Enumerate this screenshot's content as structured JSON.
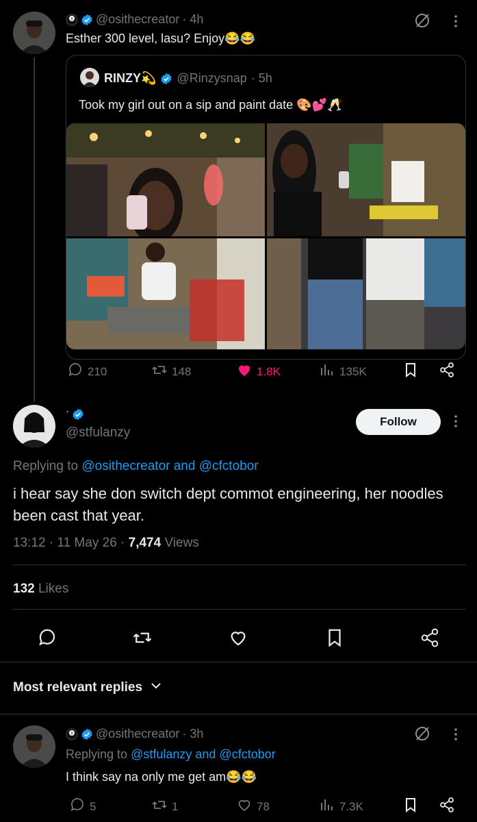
{
  "top_post": {
    "handle": "@osithecreator",
    "time": "· 4h",
    "text": "Esther 300 level, lasu? Enjoy😂😂"
  },
  "quoted_post": {
    "display_name": "RINZY💫",
    "handle": "@Rinzysnap",
    "time": "· 5h",
    "text": "Took my girl out on a sip and paint date 🎨💕🥂",
    "stats": {
      "replies": "210",
      "reposts": "148",
      "likes": "1.8K",
      "views": "135K"
    }
  },
  "main_post": {
    "handle": "@stfulanzy",
    "follow_label": "Follow",
    "replying_prefix": "Replying to",
    "replying_to": "@osithecreator and @cfctobor",
    "text": "i hear say she don switch dept commot engineering, her noodles been cast that year.",
    "time": "13:12 · 11 May 26 · ",
    "views_count": "7,474",
    "views_label": "Views",
    "likes_count": "132",
    "likes_label": "Likes"
  },
  "sort": {
    "label": "Most relevant replies"
  },
  "reply": {
    "handle": "@osithecreator",
    "time": "· 3h",
    "replying_prefix": "Replying to",
    "replying_to": "@stfulanzy and @cfctobor",
    "text": "I think say na only me get am😂😂",
    "stats": {
      "replies": "5",
      "reposts": "1",
      "likes": "78",
      "views": "7.3K"
    }
  },
  "colors": {
    "accent": "#1d9bf0",
    "like": "#f91880",
    "background": "#000000",
    "muted": "#71767b"
  }
}
